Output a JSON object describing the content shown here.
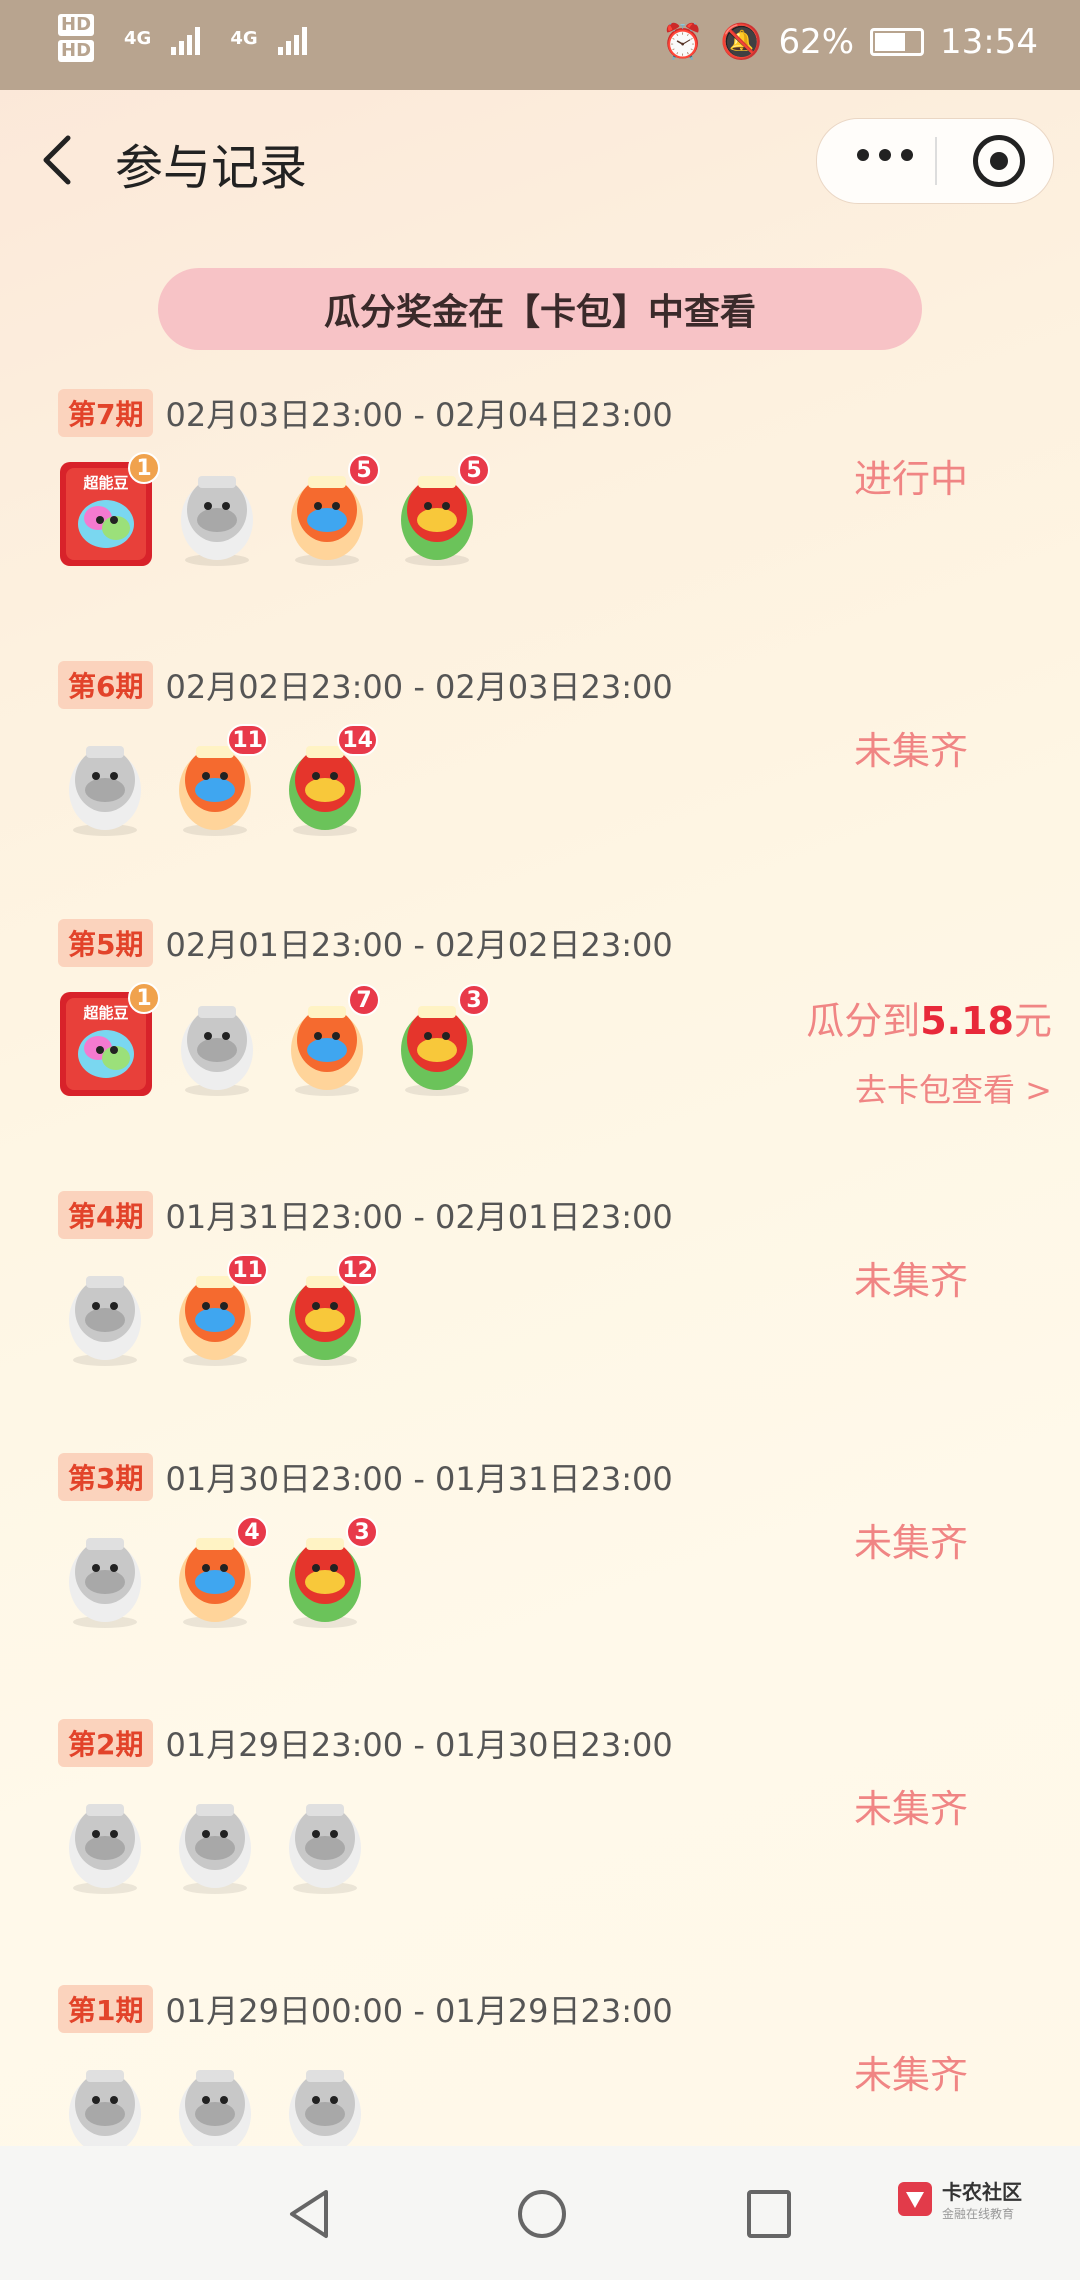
{
  "status_bar": {
    "sim1": "HD",
    "sim2": "HD",
    "net1": "4G",
    "net2": "4G",
    "battery_text": "62%",
    "time": "13:54"
  },
  "nav": {
    "title": "参与记录"
  },
  "banner": {
    "text": "瓜分奖金在【卡包】中查看"
  },
  "colors": {
    "accent_pink": "#f08584",
    "tag_bg": "#fbd3bd",
    "tag_text": "#e2432a",
    "amount_red": "#e8293a"
  },
  "periods": [
    {
      "label": "第7期",
      "date": "02月03日23:00 - 02月04日23:00",
      "status": "进行中",
      "icons": [
        {
          "type": "super",
          "badge": "1"
        },
        {
          "type": "gray-pig",
          "badge": ""
        },
        {
          "type": "lucky-orange",
          "badge": "5"
        },
        {
          "type": "yuanqi-green",
          "badge": "5"
        }
      ]
    },
    {
      "label": "第6期",
      "date": "02月02日23:00 - 02月03日23:00",
      "status": "未集齐",
      "icons": [
        {
          "type": "gray-pig",
          "badge": ""
        },
        {
          "type": "lucky-orange",
          "badge": "11"
        },
        {
          "type": "yuanqi-green",
          "badge": "14"
        }
      ]
    },
    {
      "label": "第5期",
      "date": "02月01日23:00 - 02月02日23:00",
      "status_prefix": "瓜分到",
      "status_amount": "5.18",
      "status_suffix": "元",
      "link": "去卡包查看 >",
      "icons": [
        {
          "type": "super",
          "badge": "1"
        },
        {
          "type": "gray-pig",
          "badge": ""
        },
        {
          "type": "lucky-orange",
          "badge": "7"
        },
        {
          "type": "yuanqi-green",
          "badge": "3"
        }
      ]
    },
    {
      "label": "第4期",
      "date": "01月31日23:00 - 02月01日23:00",
      "status": "未集齐",
      "icons": [
        {
          "type": "gray-pig",
          "badge": ""
        },
        {
          "type": "lucky-orange",
          "badge": "11"
        },
        {
          "type": "yuanqi-green",
          "badge": "12"
        }
      ]
    },
    {
      "label": "第3期",
      "date": "01月30日23:00 - 01月31日23:00",
      "status": "未集齐",
      "icons": [
        {
          "type": "gray-pig",
          "badge": ""
        },
        {
          "type": "lucky-orange",
          "badge": "4"
        },
        {
          "type": "yuanqi-green",
          "badge": "3"
        }
      ]
    },
    {
      "label": "第2期",
      "date": "01月29日23:00 - 01月30日23:00",
      "status": "未集齐",
      "icons": [
        {
          "type": "gray-pig",
          "badge": ""
        },
        {
          "type": "gray-lucky",
          "badge": ""
        },
        {
          "type": "gray-yuanqi",
          "badge": ""
        }
      ]
    },
    {
      "label": "第1期",
      "date": "01月29日00:00 - 01月29日23:00",
      "status": "未集齐",
      "icons": [
        {
          "type": "gray-pig",
          "badge": ""
        },
        {
          "type": "gray-lucky",
          "badge": ""
        },
        {
          "type": "gray-yuanqi",
          "badge": ""
        }
      ]
    }
  ],
  "watermark": {
    "name": "卡农社区",
    "sub": "金融在线教育"
  }
}
